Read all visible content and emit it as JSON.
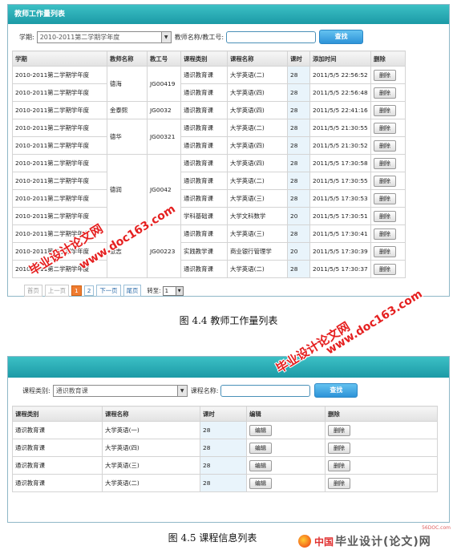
{
  "fig1": {
    "title": "教师工作量列表",
    "filter": {
      "term_label": "学期:",
      "term_value": "2010-2011第二学期学年度",
      "teacher_label": "教师名称/教工号:",
      "teacher_value": "",
      "search": "查找"
    },
    "headers": [
      "学期",
      "教师名称",
      "教工号",
      "课程类别",
      "课程名称",
      "课时",
      "添加时间",
      "删除"
    ],
    "delete_label": "删除",
    "groups": [
      {
        "teacher": "德海",
        "id": "JG00419",
        "rows": [
          {
            "term": "2010-2011第二学期学年度",
            "type": "通识教育课",
            "course": "大学英语(二)",
            "hours": "28",
            "time": "2011/5/5 22:56:52"
          },
          {
            "term": "2010-2011第二学期学年度",
            "type": "通识教育课",
            "course": "大学英语(四)",
            "hours": "28",
            "time": "2011/5/5 22:56:48"
          }
        ]
      },
      {
        "teacher": "金泰熙",
        "id": "JG0032",
        "rows": [
          {
            "term": "2010-2011第二学期学年度",
            "type": "通识教育课",
            "course": "大学英语(四)",
            "hours": "28",
            "time": "2011/5/5 22:41:16"
          }
        ]
      },
      {
        "teacher": "德华",
        "id": "JG00321",
        "rows": [
          {
            "term": "2010-2011第二学期学年度",
            "type": "通识教育课",
            "course": "大学英语(二)",
            "hours": "28",
            "time": "2011/5/5 21:30:55"
          },
          {
            "term": "2010-2011第二学期学年度",
            "type": "通识教育课",
            "course": "大学英语(四)",
            "hours": "28",
            "time": "2011/5/5 21:30:52"
          }
        ]
      },
      {
        "teacher": "德润",
        "id": "JG0042",
        "rows": [
          {
            "term": "2010-2011第二学期学年度",
            "type": "通识教育课",
            "course": "大学英语(四)",
            "hours": "28",
            "time": "2011/5/5 17:30:58"
          },
          {
            "term": "2010-2011第二学期学年度",
            "type": "通识教育课",
            "course": "大学英语(二)",
            "hours": "28",
            "time": "2011/5/5 17:30:55"
          },
          {
            "term": "2010-2011第二学期学年度",
            "type": "通识教育课",
            "course": "大学英语(三)",
            "hours": "28",
            "time": "2011/5/5 17:30:53"
          },
          {
            "term": "2010-2011第二学期学年度",
            "type": "学科基础课",
            "course": "大学文科数学",
            "hours": "20",
            "time": "2011/5/5 17:30:51"
          }
        ]
      },
      {
        "teacher": "张志",
        "id": "JG00223",
        "rows": [
          {
            "term": "2010-2011第二学期学年度",
            "type": "通识教育课",
            "course": "大学英语(三)",
            "hours": "28",
            "time": "2011/5/5 17:30:41"
          },
          {
            "term": "2010-2011第二学期学年度",
            "type": "实践教学课",
            "course": "商业银行管理学",
            "hours": "20",
            "time": "2011/5/5 17:30:39"
          },
          {
            "term": "2010-2011第二学期学年度",
            "type": "通识教育课",
            "course": "大学英语(二)",
            "hours": "28",
            "time": "2011/5/5 17:30:37"
          }
        ]
      }
    ],
    "pager": {
      "first": "首页",
      "prev": "上一页",
      "p1": "1",
      "p2": "2",
      "next": "下一页",
      "last": "尾页",
      "goto": "转至:",
      "goto_value": "1"
    },
    "caption": "图 4.4  教师工作量列表"
  },
  "fig2": {
    "filter": {
      "type_label": "课程类别:",
      "type_value": "通识教育课",
      "name_label": "课程名称:",
      "name_value": "",
      "search": "查找"
    },
    "headers": [
      "课程类别",
      "课程名称",
      "课时",
      "编辑",
      "删除"
    ],
    "edit_label": "编辑",
    "delete_label": "删除",
    "rows": [
      {
        "type": "通识教育课",
        "course": "大学英语(一)",
        "hours": "28"
      },
      {
        "type": "通识教育课",
        "course": "大学英语(四)",
        "hours": "28"
      },
      {
        "type": "通识教育课",
        "course": "大学英语(三)",
        "hours": "28"
      },
      {
        "type": "通识教育课",
        "course": "大学英语(二)",
        "hours": "28"
      }
    ],
    "caption": "图 4.5  课程信息列表"
  },
  "watermarks": {
    "a_cn": "毕业设计论文网",
    "a_url": "www.doc163.com",
    "b_cn": "毕业设计论文网",
    "b_url": "www.doc163.com"
  },
  "logo": {
    "zhongguo": "中国",
    "name": "毕业设计(论文)网",
    "url": "56DOC.com"
  }
}
